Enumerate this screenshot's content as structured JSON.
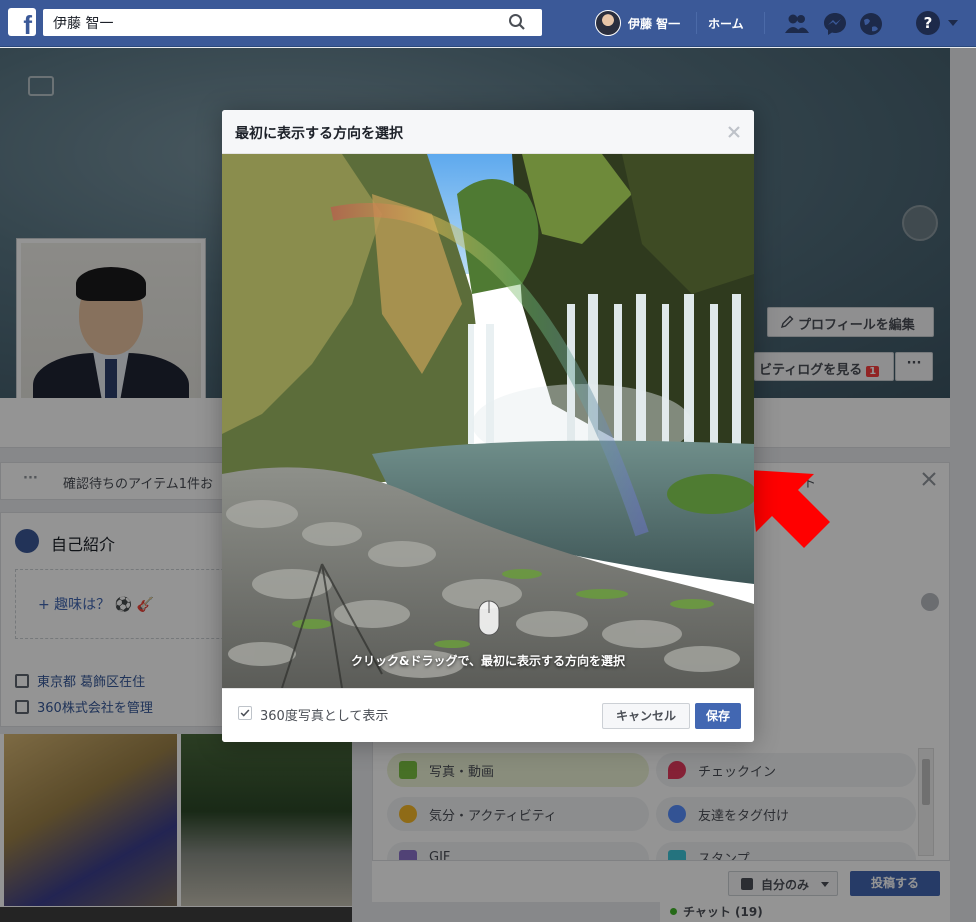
{
  "topbar": {
    "search_value": "伊藤 智一",
    "user_name": "伊藤 智一",
    "home_label": "ホーム",
    "help_glyph": "?"
  },
  "profile": {
    "edit_profile_label": "プロフィールを編集",
    "activity_log_label": "ビティログを見る",
    "activity_badge": "1",
    "more_label": "···"
  },
  "left": {
    "pending_dots": "···",
    "pending_text": "確認待ちのアイテム1件お",
    "intro_title": "自己紹介",
    "hobby_text": "+ 趣味は？ ⚽ 🎸",
    "location": "東京都 葛飾区在住",
    "manages": "360株式会社を管理"
  },
  "composer": {
    "title_fragment": "ト",
    "options": [
      {
        "label": "写真・動画"
      },
      {
        "label": "チェックイン"
      },
      {
        "label": "気分・アクティビティ"
      },
      {
        "label": "友達をタグ付け"
      },
      {
        "label": "GIF"
      },
      {
        "label": "スタンプ"
      }
    ],
    "privacy_label": "自分のみ",
    "post_label": "投稿する",
    "chat_label": "チャット (19)"
  },
  "modal": {
    "title": "最初に表示する方向を選択",
    "hint": "クリック&ドラッグで、最初に表示する方向を選択",
    "checkbox_label": "360度写真として表示",
    "cancel_label": "キャンセル",
    "save_label": "保存"
  },
  "colors": {
    "brand": "#3b5998",
    "primary_button": "#4267b2",
    "annotation_arrow": "#ff0000"
  },
  "icons": [
    "facebook-logo-icon",
    "search-icon",
    "friends-icon",
    "messenger-icon",
    "globe-icon",
    "help-icon",
    "pencil-icon",
    "close-icon",
    "mouse-icon",
    "check-icon",
    "lock-icon"
  ]
}
